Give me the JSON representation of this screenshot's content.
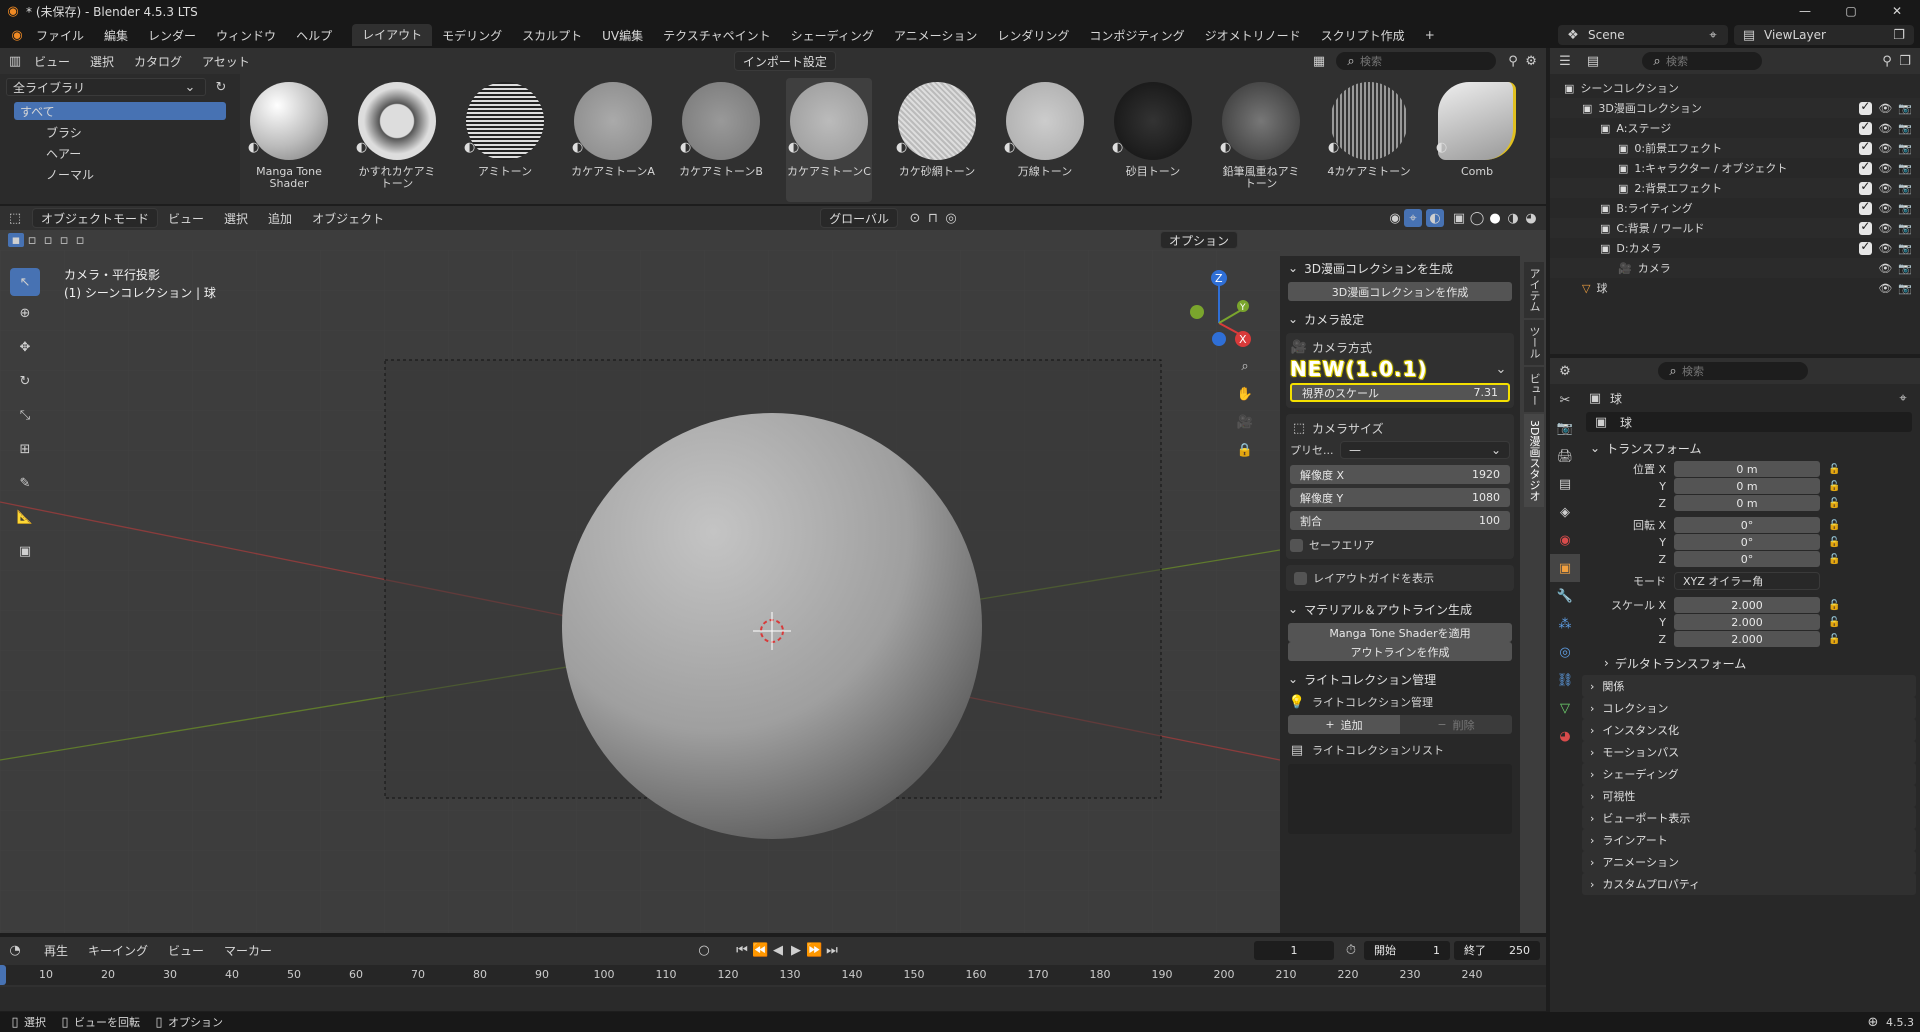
{
  "window": {
    "title": "* (未保存) - Blender 4.5.3 LTS",
    "min": "—",
    "max": "▢",
    "close": "✕"
  },
  "menu": [
    "ファイル",
    "編集",
    "レンダー",
    "ウィンドウ",
    "ヘルプ"
  ],
  "workspaces": [
    "レイアウト",
    "モデリング",
    "スカルプト",
    "UV編集",
    "テクスチャペイント",
    "シェーディング",
    "アニメーション",
    "レンダリング",
    "コンポジティング",
    "ジオメトリノード",
    "スクリプト作成"
  ],
  "workspace_add": "+",
  "scene": {
    "label": "Scene",
    "view_layer": "ViewLayer"
  },
  "asset": {
    "menu": [
      "ビュー",
      "選択",
      "カタログ",
      "アセット"
    ],
    "import": "インポート設定",
    "search_placeholder": "検索",
    "library": "全ライブラリ",
    "tree": [
      "すべて",
      "ブラシ",
      "ヘアー",
      "ノーマル"
    ],
    "items": [
      "Manga Tone Shader",
      "かすれカケアミトーン",
      "アミトーン",
      "カケアミトーンA",
      "カケアミトーンB",
      "カケアミトーンC",
      "カケ砂網トーン",
      "万線トーン",
      "砂目トーン",
      "鉛筆風重ねアミトーン",
      "4カケアミトーン",
      "Comb"
    ]
  },
  "viewport": {
    "mode": "オブジェクトモード",
    "menu": [
      "ビュー",
      "選択",
      "追加",
      "オブジェクト"
    ],
    "orientation": "グローバル",
    "options": "オプション",
    "info1": "カメラ・平行投影",
    "info2": "(1) シーンコレクション | 球",
    "gizmo": {
      "x": "X",
      "y": "Y",
      "z": "Z"
    }
  },
  "npanel": {
    "tabs": [
      "アイテム",
      "ツール",
      "ビュー",
      "3D漫画スタジオ"
    ],
    "sec1": {
      "title": "3D漫画コレクションを生成",
      "btn": "3D漫画コレクションを作成"
    },
    "sec2": {
      "title": "カメラ設定",
      "camtype": "カメラ方式",
      "badge": "NEW(1.0.1)",
      "scale_label": "視界のスケール",
      "scale_value": "7.31",
      "camsize": "カメラサイズ",
      "preset_label": "プリセ...",
      "preset_value": "—",
      "resx_label": "解像度 X",
      "resx": "1920",
      "resy_label": "解像度 Y",
      "resy": "1080",
      "ratio_label": "割合",
      "ratio": "100",
      "safe": "セーフエリア",
      "guide": "レイアウトガイドを表示"
    },
    "sec3": {
      "title": "マテリアル＆アウトライン生成",
      "btn1": "Manga Tone Shaderを適用",
      "btn2": "アウトラインを作成"
    },
    "sec4": {
      "title": "ライトコレクション管理",
      "sub": "ライトコレクション管理",
      "add": "追加",
      "del": "削除",
      "list": "ライトコレクションリスト"
    }
  },
  "outliner": {
    "search_placeholder": "検索",
    "items": [
      {
        "label": "シーンコレクション",
        "depth": 0
      },
      {
        "label": "3D漫画コレクション",
        "depth": 1
      },
      {
        "label": "A:ステージ",
        "depth": 2
      },
      {
        "label": "0:前景エフェクト",
        "depth": 3
      },
      {
        "label": "1:キャラクター / オブジェクト",
        "depth": 3
      },
      {
        "label": "2:背景エフェクト",
        "depth": 3
      },
      {
        "label": "B:ライティング",
        "depth": 2
      },
      {
        "label": "C:背景 / ワールド",
        "depth": 2
      },
      {
        "label": "D:カメラ",
        "depth": 2
      },
      {
        "label": "カメラ",
        "depth": 3
      },
      {
        "label": "球",
        "depth": 1
      }
    ]
  },
  "props": {
    "search_placeholder": "検索",
    "object": "球",
    "data_name": "球",
    "transform": "トランスフォーム",
    "loc_label": "位置 X",
    "loc": [
      "0 m",
      "0 m",
      "0 m"
    ],
    "rot_label": "回転 X",
    "rot": [
      "0°",
      "0°",
      "0°"
    ],
    "mode_label": "モード",
    "mode": "XYZ オイラー角",
    "scale_label": "スケール X",
    "scale": [
      "2.000",
      "2.000",
      "2.000"
    ],
    "y": "Y",
    "z": "Z",
    "delta": "デルタトランスフォーム",
    "sections": [
      "関係",
      "コレクション",
      "インスタンス化",
      "モーションパス",
      "シェーディング",
      "可視性",
      "ビューポート表示",
      "ラインアート",
      "アニメーション",
      "カスタムプロパティ"
    ]
  },
  "timeline": {
    "menu": [
      "再生",
      "キーイング",
      "ビュー",
      "マーカー"
    ],
    "frame": "1",
    "start_label": "開始",
    "start": "1",
    "end_label": "終了",
    "end": "250",
    "ticks": [
      "10",
      "20",
      "30",
      "40",
      "50",
      "60",
      "70",
      "80",
      "90",
      "100",
      "110",
      "120",
      "130",
      "140",
      "150",
      "160",
      "170",
      "180",
      "190",
      "200",
      "210",
      "220",
      "230",
      "240"
    ]
  },
  "status": {
    "select": "選択",
    "rotate": "ビューを回転",
    "options": "オプション",
    "version": "4.5.3"
  }
}
